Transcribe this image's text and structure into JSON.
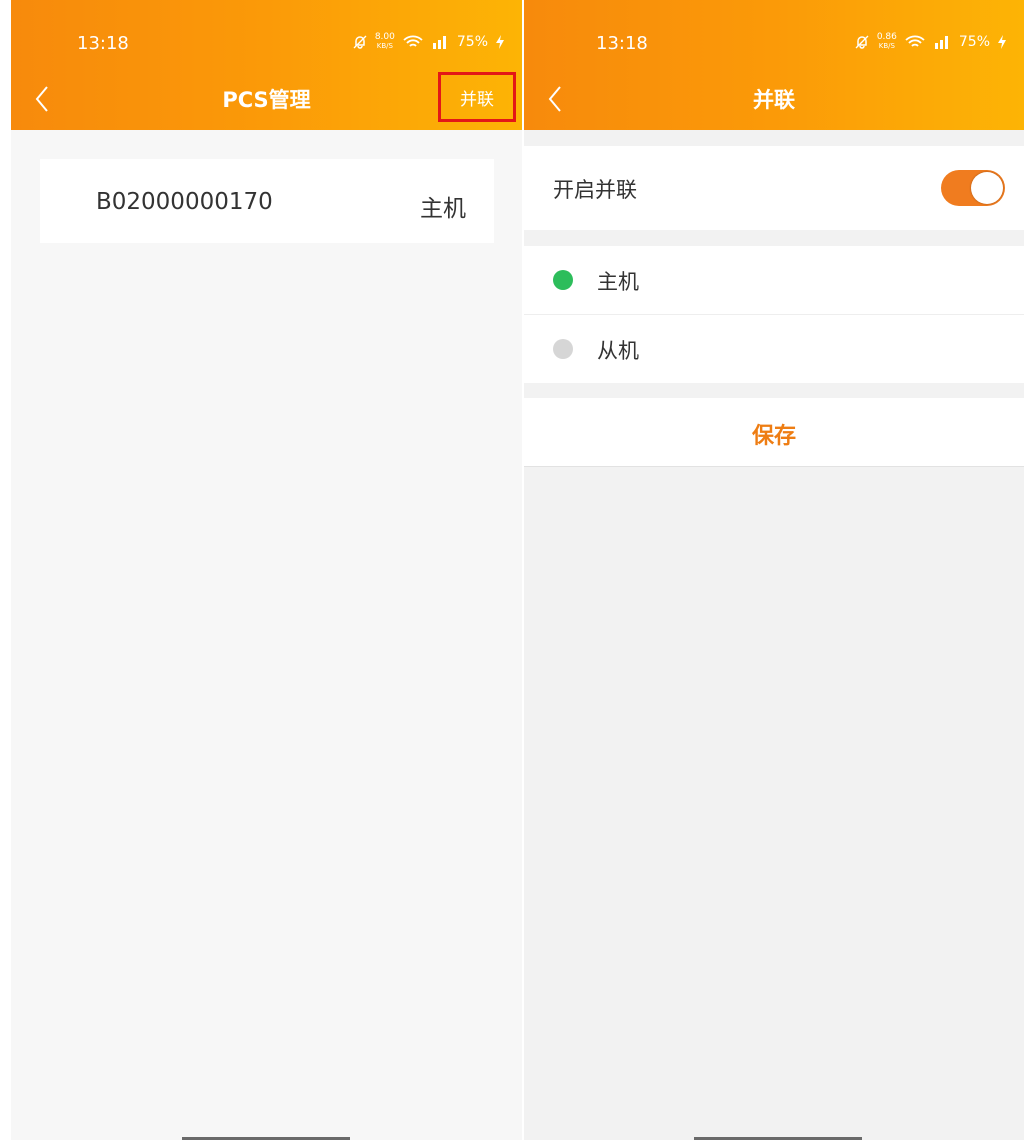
{
  "left_screen": {
    "status_bar": {
      "time": "13:18",
      "net_speed_value": "8.00",
      "net_speed_unit": "KB/S",
      "battery": "75%"
    },
    "header": {
      "title": "PCS管理",
      "action_label": "并联"
    },
    "devices": [
      {
        "id": "B02000000170",
        "role": "主机"
      }
    ]
  },
  "right_screen": {
    "status_bar": {
      "time": "13:18",
      "net_speed_value": "0.86",
      "net_speed_unit": "KB/S",
      "battery": "75%"
    },
    "header": {
      "title": "并联"
    },
    "toggle": {
      "label": "开启并联",
      "on": true
    },
    "options": [
      {
        "label": "主机",
        "selected": true
      },
      {
        "label": "从机",
        "selected": false
      }
    ],
    "save_label": "保存"
  },
  "colors": {
    "accent_orange": "#f07c1f",
    "selected_green": "#2dbd5b",
    "highlight_red": "#e31717"
  }
}
